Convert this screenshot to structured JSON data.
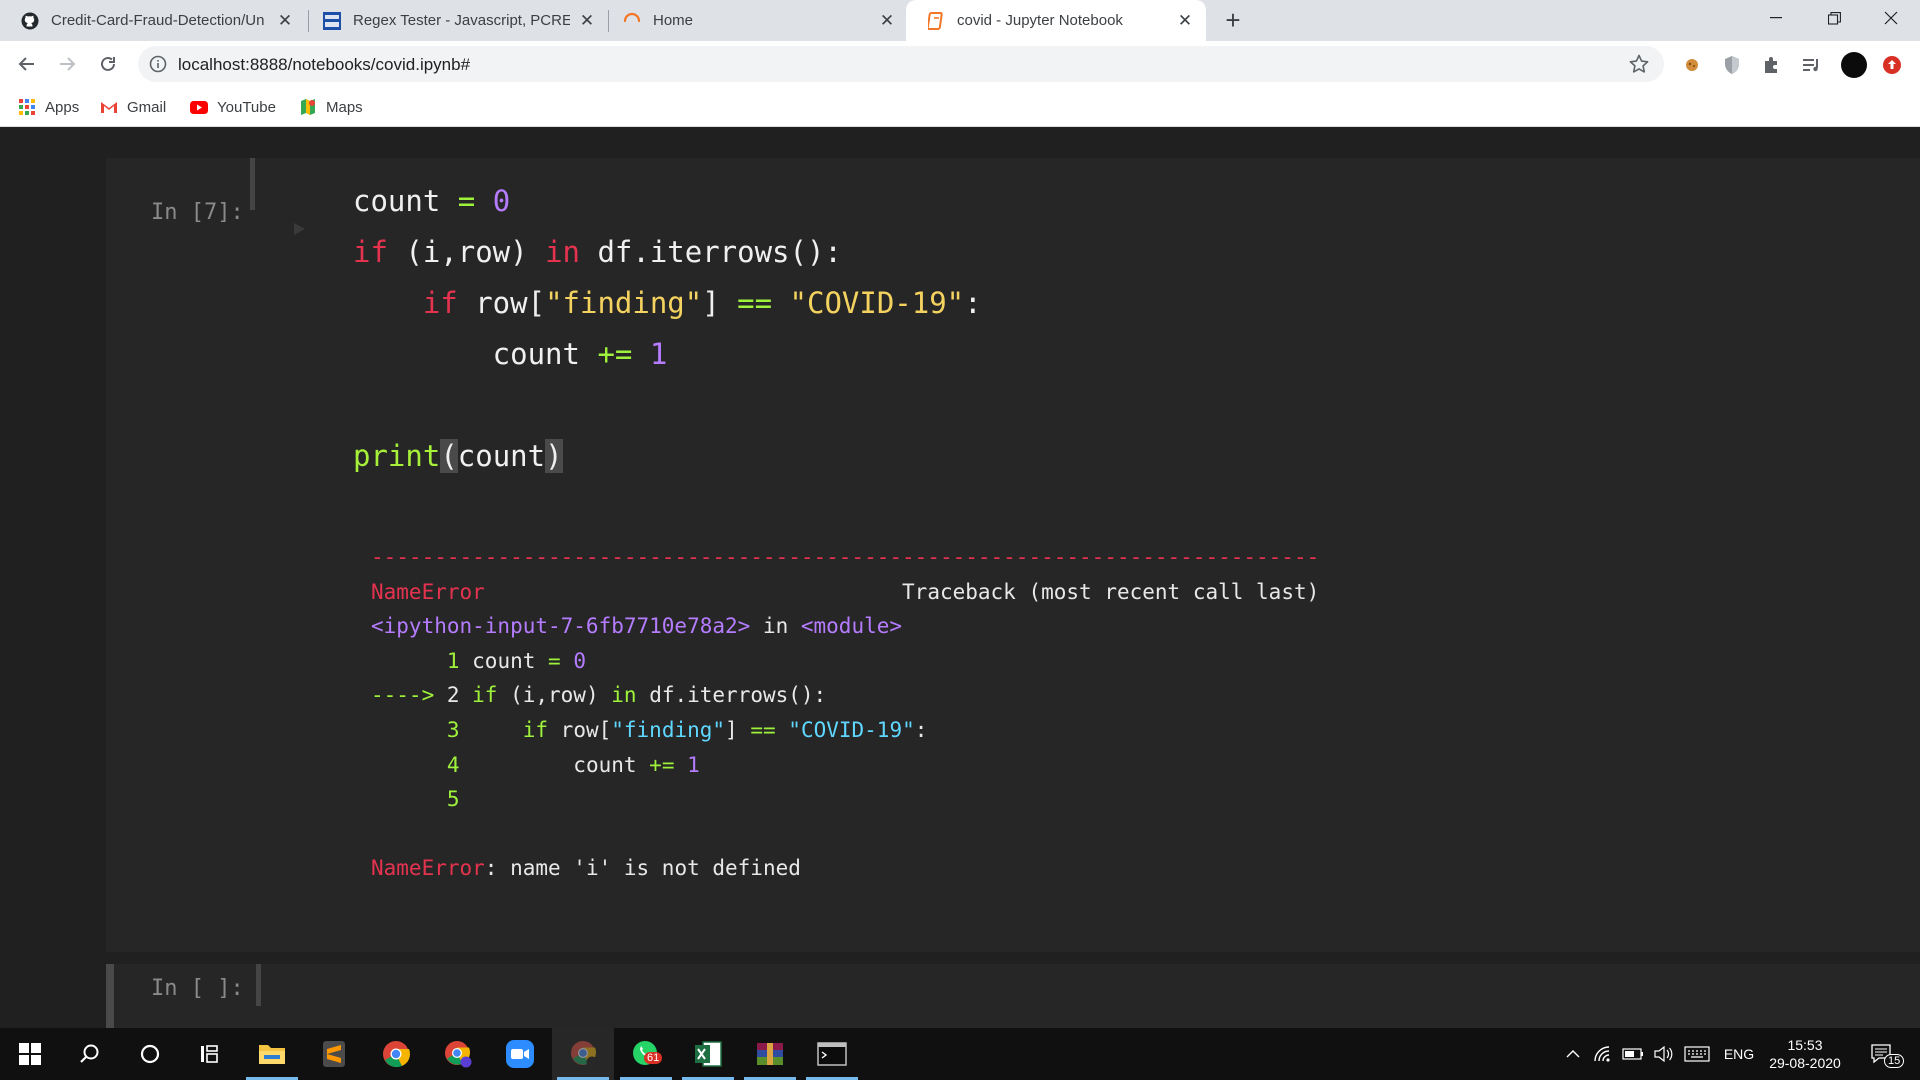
{
  "browser": {
    "tabs": [
      {
        "title": "Credit-Card-Fraud-Detection/Un",
        "icon": "github-icon",
        "active": false
      },
      {
        "title": "Regex Tester - Javascript, PCRE, P",
        "icon": "regex-icon",
        "active": false
      },
      {
        "title": "Home",
        "icon": "jupyter-loading-icon",
        "active": false
      },
      {
        "title": "covid - Jupyter Notebook",
        "icon": "notebook-icon",
        "active": true
      }
    ],
    "url": "localhost:8888/notebooks/covid.ipynb#",
    "bookmarks": [
      {
        "label": "Apps",
        "icon": "apps-grid-icon"
      },
      {
        "label": "Gmail",
        "icon": "gmail-icon"
      },
      {
        "label": "YouTube",
        "icon": "youtube-icon"
      },
      {
        "label": "Maps",
        "icon": "maps-icon"
      }
    ]
  },
  "notebook": {
    "cell1_prompt": "In [7]:",
    "empty_prompt": "In [ ]:",
    "traceback": {
      "dashes": "---------------------------------------------------------------------------",
      "error_name": "NameError",
      "header_right": "Traceback (most recent call last)",
      "input_ref": "<ipython-input-7-6fb7710e78a2>",
      "in_word": " in ",
      "module": "<module>",
      "final_message": ": name 'i' is not defined"
    }
  },
  "taskbar": {
    "time": "15:53",
    "date": "29-08-2020",
    "language": "ENG",
    "whatsapp_badge": "61",
    "notification_count": "15"
  },
  "colors": {
    "notebook_bg": "#202020",
    "cell_bg": "#262626",
    "keyword": "#e5334f",
    "operator": "#9ff23b",
    "number": "#b57cff",
    "string": "#f4d25f"
  }
}
